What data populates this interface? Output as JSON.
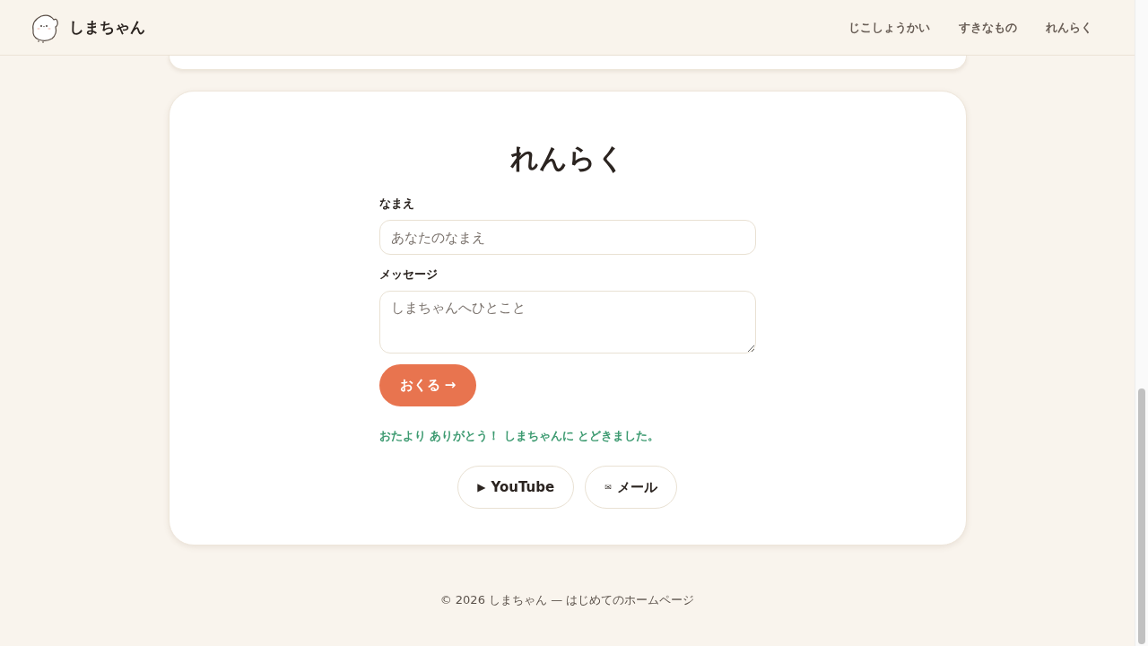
{
  "header": {
    "title": "しまちゃん",
    "nav": [
      {
        "label": "じこしょうかい"
      },
      {
        "label": "すきなもの"
      },
      {
        "label": "れんらく"
      }
    ]
  },
  "contact": {
    "title": "れんらく",
    "fields": [
      {
        "kind": "input",
        "label": "なまえ",
        "placeholder": "あなたのなまえ"
      },
      {
        "kind": "textarea",
        "label": "メッセージ",
        "placeholder": "しまちゃんへひとこと"
      }
    ],
    "submit": "おくる →",
    "success_message": "おたより ありがとう！ しまちゃんに とどきました。",
    "links": [
      {
        "icon": "▶",
        "label": "YouTube"
      },
      {
        "icon": "✉",
        "label": "メール"
      }
    ]
  },
  "footer": {
    "text": "© 2026 しまちゃん — はじめてのホームページ"
  }
}
